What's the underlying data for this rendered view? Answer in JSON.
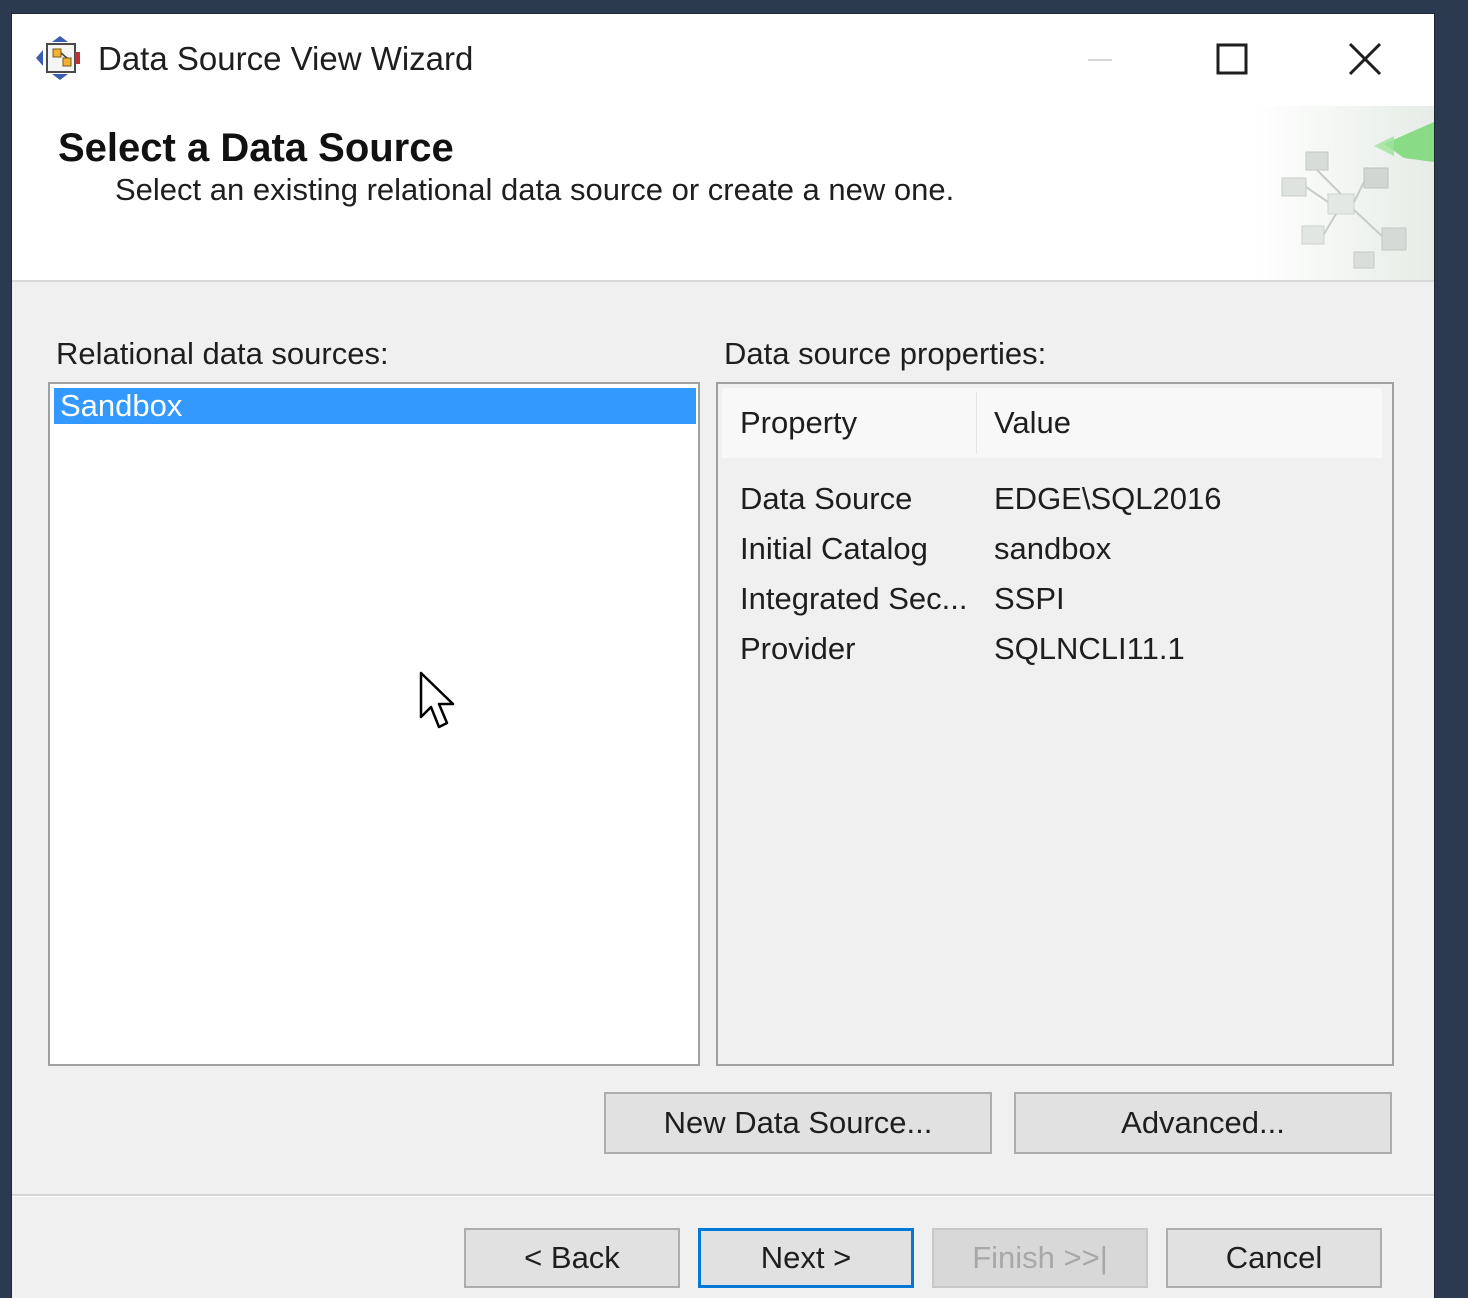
{
  "window": {
    "title": "Data Source View Wizard"
  },
  "header": {
    "title": "Select a Data Source",
    "subtitle": "Select an existing relational data source or create a new one."
  },
  "sources": {
    "label": "Relational data sources:",
    "items": [
      {
        "label": "Sandbox",
        "selected": true
      }
    ]
  },
  "properties": {
    "label": "Data source properties:",
    "columns": {
      "property": "Property",
      "value": "Value"
    },
    "rows": [
      {
        "property": "Data Source",
        "value": "EDGE\\SQL2016"
      },
      {
        "property": "Initial Catalog",
        "value": "sandbox"
      },
      {
        "property": "Integrated Sec...",
        "value": "SSPI"
      },
      {
        "property": "Provider",
        "value": "SQLNCLI11.1"
      }
    ]
  },
  "actions": {
    "new_data_source": "New Data Source...",
    "advanced": "Advanced..."
  },
  "nav": {
    "back": "< Back",
    "next": "Next >",
    "finish": "Finish >>|",
    "cancel": "Cancel"
  },
  "colors": {
    "selection": "#3399ff",
    "focus_border": "#0078d7",
    "dialog_bg": "#f0f0f0"
  }
}
